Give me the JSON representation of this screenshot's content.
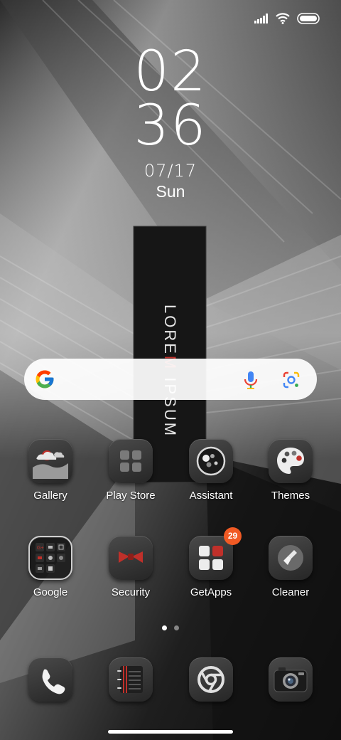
{
  "status_bar": {
    "icons": [
      "signal-icon",
      "wifi-icon",
      "battery-icon"
    ]
  },
  "wallpaper": {
    "sign_left": "LORE",
    "sign_accent": "M",
    "sign_right": " IPSUM",
    "accent_color": "#c0302a"
  },
  "clock": {
    "hours": "02",
    "minutes": "36",
    "date": "07/17",
    "day": "Sun"
  },
  "search_bar": {
    "icons": [
      "google-g-icon",
      "microphone-icon",
      "google-lens-icon"
    ]
  },
  "apps_row1": [
    {
      "label": "Gallery",
      "icon": "gallery-icon"
    },
    {
      "label": "Play Store",
      "icon": "play-store-icon"
    },
    {
      "label": "Assistant",
      "icon": "assistant-icon"
    },
    {
      "label": "Themes",
      "icon": "palette-icon"
    }
  ],
  "apps_row2": [
    {
      "label": "Google",
      "icon": "google-folder-icon"
    },
    {
      "label": "Security",
      "icon": "security-icon"
    },
    {
      "label": "GetApps",
      "icon": "getapps-icon",
      "badge": "29"
    },
    {
      "label": "Cleaner",
      "icon": "cleaner-icon"
    }
  ],
  "page_indicator": {
    "pages": 2,
    "active": 1
  },
  "dock": [
    {
      "icon": "phone-icon"
    },
    {
      "icon": "notes-icon"
    },
    {
      "icon": "chrome-icon"
    },
    {
      "icon": "camera-icon"
    }
  ],
  "colors": {
    "badge": "#f15a24",
    "search_bg": "#ffffff"
  }
}
